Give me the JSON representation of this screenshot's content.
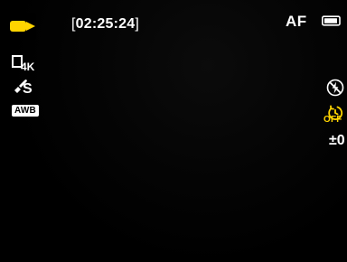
{
  "top": {
    "mode_icon": "video-camera-icon",
    "record_time_prefix": "[",
    "record_time_value": "02:25:24",
    "record_time_suffix": "]",
    "focus_mode": "AF",
    "battery_icon": "battery-icon"
  },
  "left": {
    "resolution_icon": "film-frame-icon",
    "resolution_label": "4K",
    "sharpness_icon": "brush-icon",
    "sharpness_label": "S",
    "white_balance_label": "AWB"
  },
  "right": {
    "flash_icon": "flash-off-icon",
    "timer_icon": "self-timer-icon",
    "timer_label": "OFF",
    "exposure_comp": "±0"
  },
  "colors": {
    "accent_yellow": "#ffd400",
    "background": "#000000",
    "text": "#ffffff"
  }
}
